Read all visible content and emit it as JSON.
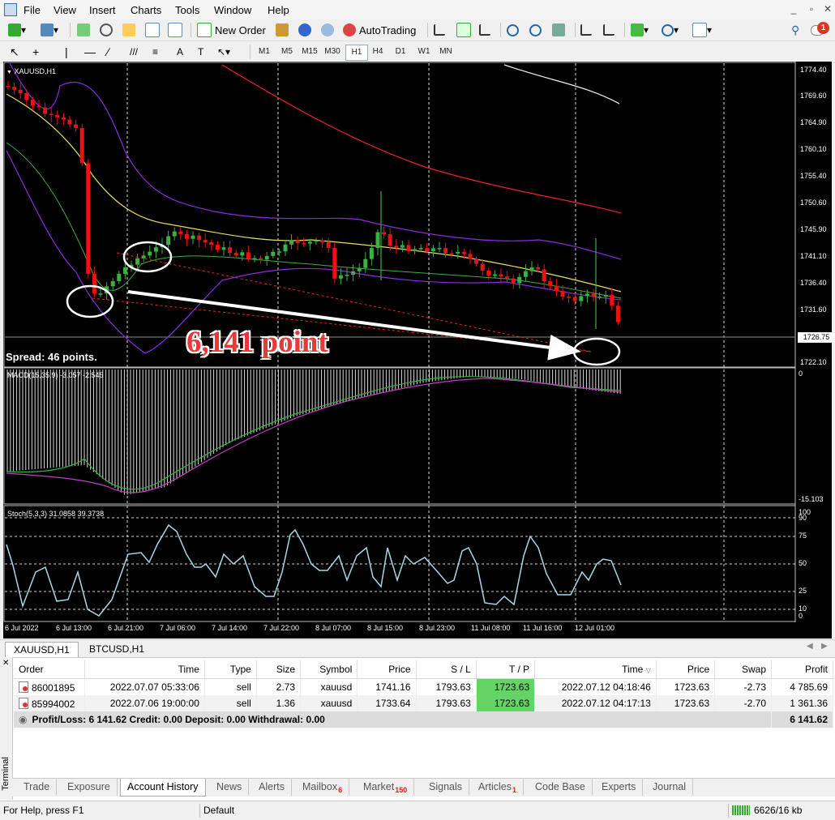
{
  "menu": [
    "File",
    "View",
    "Insert",
    "Charts",
    "Tools",
    "Window",
    "Help"
  ],
  "toolbar": {
    "new_order": "New Order",
    "autotrading": "AutoTrading",
    "timeframes": [
      "M1",
      "M5",
      "M15",
      "M30",
      "H1",
      "H4",
      "D1",
      "W1",
      "MN"
    ],
    "active_timeframe": "H1",
    "notification_count": "1"
  },
  "chart": {
    "symbol_label": "XAUUSD,H1",
    "current_price": "1726.75",
    "price_ticks": [
      "1774.40",
      "1769.60",
      "1764.90",
      "1760.10",
      "1755.40",
      "1750.60",
      "1745.90",
      "1741.10",
      "1736.40",
      "1731.60",
      "1722.10"
    ],
    "spread": "Spread: 46 points.",
    "annotation": "6,141 point",
    "macd_label": "MACD(15,35,9) -3.057 -2.545",
    "macd_ticks": [
      "0",
      "-15.103"
    ],
    "stoch_label": "Stoch(5,3,3) 31.0858 39.3738",
    "stoch_ticks": [
      "100",
      "90",
      "75",
      "50",
      "25",
      "10",
      "0"
    ],
    "time_ticks": [
      "6 Jul 2022",
      "6 Jul 13:00",
      "6 Jul 21:00",
      "7 Jul 06:00",
      "7 Jul 14:00",
      "7 Jul 22:00",
      "8 Jul 07:00",
      "8 Jul 15:00",
      "8 Jul 23:00",
      "11 Jul 08:00",
      "11 Jul 16:00",
      "12 Jul 01:00"
    ]
  },
  "chart_tabs": [
    "XAUUSD,H1",
    "BTCUSD,H1"
  ],
  "terminal": {
    "columns": [
      "Order",
      "Time",
      "Type",
      "Size",
      "Symbol",
      "Price",
      "S / L",
      "T / P",
      "Time",
      "Price",
      "Swap",
      "Profit"
    ],
    "rows": [
      {
        "order": "86001895",
        "open_time": "2022.07.07 05:33:06",
        "type": "sell",
        "size": "2.73",
        "symbol": "xauusd",
        "price": "1741.16",
        "sl": "1793.63",
        "tp": "1723.63",
        "close_time": "2022.07.12 04:18:46",
        "close_price": "1723.63",
        "swap": "-2.73",
        "profit": "4 785.69"
      },
      {
        "order": "85994002",
        "open_time": "2022.07.06 19:00:00",
        "type": "sell",
        "size": "1.36",
        "symbol": "xauusd",
        "price": "1733.64",
        "sl": "1793.63",
        "tp": "1723.63",
        "close_time": "2022.07.12 04:17:13",
        "close_price": "1723.63",
        "swap": "-2.70",
        "profit": "1 361.36"
      }
    ],
    "summary": "Profit/Loss: 6 141.62  Credit: 0.00  Deposit: 0.00  Withdrawal: 0.00",
    "summary_total": "6 141.62",
    "side_label": "Terminal",
    "tabs": [
      {
        "label": "Trade",
        "badge": ""
      },
      {
        "label": "Exposure",
        "badge": ""
      },
      {
        "label": "Account History",
        "badge": ""
      },
      {
        "label": "News",
        "badge": ""
      },
      {
        "label": "Alerts",
        "badge": ""
      },
      {
        "label": "Mailbox",
        "badge": "6"
      },
      {
        "label": "Market",
        "badge": "150"
      },
      {
        "label": "Signals",
        "badge": ""
      },
      {
        "label": "Articles",
        "badge": "1"
      },
      {
        "label": "Code Base",
        "badge": ""
      },
      {
        "label": "Experts",
        "badge": ""
      },
      {
        "label": "Journal",
        "badge": ""
      }
    ],
    "active_tab": "Account History"
  },
  "status": {
    "help": "For Help, press F1",
    "profile": "Default",
    "traffic": "6626/16 kb"
  },
  "colors": {
    "bull": "#3cb043",
    "bear": "#e11",
    "macd_signal": "#c040c0",
    "bands": "#8a2be2",
    "ma_red": "#e22",
    "ma_white": "#f0f0f0",
    "ma_yellow": "#e8e060",
    "stoch": "#a8d8e8",
    "tp_highlight": "#66d366"
  }
}
